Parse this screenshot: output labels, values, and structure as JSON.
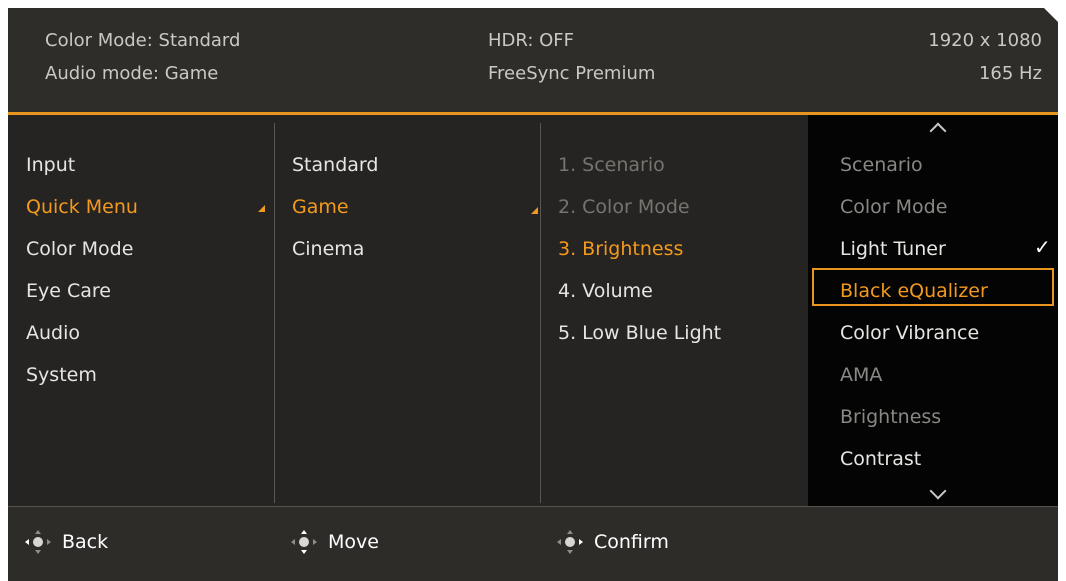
{
  "header": {
    "color_mode": "Color Mode: Standard",
    "audio_mode": "Audio mode: Game",
    "hdr": "HDR: OFF",
    "freesync": "FreeSync Premium",
    "resolution": "1920 x 1080",
    "refresh_rate": "165 Hz"
  },
  "menu": {
    "col1": [
      "Input",
      "Quick Menu",
      "Color Mode",
      "Eye Care",
      "Audio",
      "System"
    ],
    "col2": [
      "Standard",
      "Game",
      "Cinema"
    ],
    "col3": [
      "1. Scenario",
      "2. Color Mode",
      "3. Brightness",
      "4. Volume",
      "5. Low Blue Light"
    ],
    "col4": [
      "Scenario",
      "Color Mode",
      "Light Tuner",
      "Black eQualizer",
      "Color Vibrance",
      "AMA",
      "Brightness",
      "Contrast"
    ],
    "col4_checked": "Light Tuner",
    "check_mark": "✓"
  },
  "footer": {
    "back": "Back",
    "move": "Move",
    "confirm": "Confirm"
  },
  "colors": {
    "accent": "#f39a1e",
    "background": "#262422",
    "header_bg": "#2f2d2a",
    "selected_col_bg": "#040404"
  }
}
